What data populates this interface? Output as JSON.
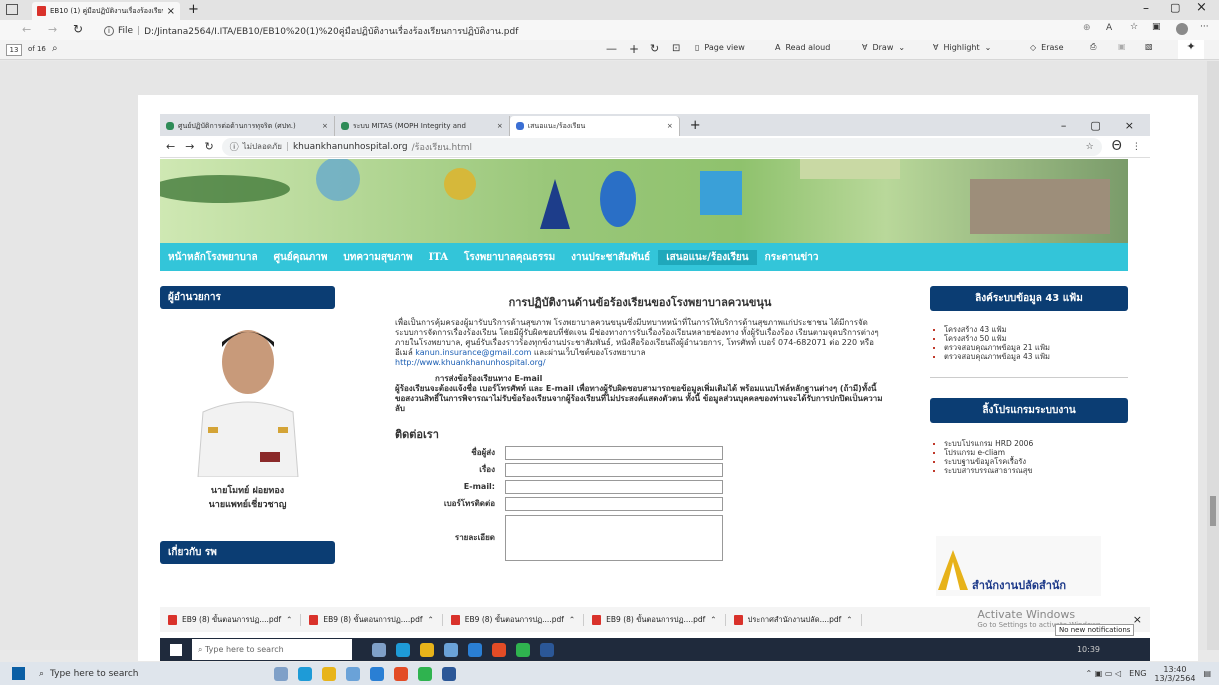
{
  "outer": {
    "tab_title": "EB10 (1) คู่มือปฏิบัติงานเรื่องร้องเรียน...",
    "tab_close": "×",
    "new_tab": "+",
    "file_label": "File",
    "url": "D:/Jintana2564/I.ITA/EB10/EB10%20(1)%20คู่มือปฏิบัติงานเรื่องร้องเรียนการปฏิบัติงาน.pdf",
    "page_num": "13",
    "page_of": "of 16",
    "page_view": "Page view",
    "read_aloud": "Read aloud",
    "draw": "Draw",
    "highlight": "Highlight",
    "erase": "Erase",
    "search_placeholder": "Type here to search",
    "lang": "ENG",
    "time": "13:40",
    "date": "13/3/2564"
  },
  "inner": {
    "tabs": [
      "ศูนย์ปฏิบัติการต่อต้านการทุจริต (ศปท.)",
      "ระบบ MITAS (MOPH Integrity and",
      "เสนอแนะ/ร้องเรียน"
    ],
    "not_secure": "ไม่ปลอดภัย",
    "url_host": "khuankhanunhospital.org",
    "url_path": "/ร้องเรียน.html",
    "nav": [
      "หน้าหลักโรงพยาบาล",
      "ศูนย์คุณภาพ",
      "บทความสุขภาพ",
      "ITA",
      "โรงพยาบาลคุณธรรม",
      "งานประชาสัมพันธ์",
      "เสนอแนะ/ร้องเรียน",
      "กระดานข่าว"
    ],
    "left_head": "ผู้อำนวยการ",
    "director_name": "นายโมทย์ ฝอยทอง",
    "director_title": "นายแพทย์เชี่ยวชาญ",
    "about_head": "เกี่ยวกับ รพ",
    "main_title": "การปฏิบัติงานด้านข้อร้องเรียนของโรงพยาบาลควนขนุน",
    "para1": "เพื่อเป็นการคุ้มครองผู้มารับบริการด้านสุขภาพ โรงพยาบาลควนขนุนซึ่งมีบทบาทหน้าที่ในการให้บริการด้านสุขภาพแก่ประชาชน ได้มีการจัดระบบการจัดการเรื่องร้องเรียน โดยมีผู้รับผิดชอบที่ชัดเจน มีช่องทางการรับเรื่องร้องเรียนหลายช่องทาง ทั้งผู้รับเรื่องร้อง เรียนตามจุดบริการต่างๆภายในโรงพยาบาล, ศูนย์รับเรื่องราวร้องทุกข์งานประชาสัมพันธ์, หนังสือร้องเรียนถึงผู้อำนวยการ, โทรศัพท์ เบอร์ 074-682071 ต่อ 220 หรือ อีเมล์",
    "email": "kanun.insurance@gmail.com",
    "para1b": "และผ่านเว็บไซต์ของโรงพยาบาล",
    "site_link": "http://www.khuankhanunhospital.org/",
    "email_head": "การส่งข้อร้องเรียนทาง E-mail",
    "para2": "ผู้ร้องเรียนจะต้องแจ้งชื่อ เบอร์โทรศัพท์ และ E-mail เพื่อทางผู้รับผิดชอบสามารถขอข้อมูลเพิ่มเติมได้ พร้อมแนบไฟล์หลักฐานต่างๆ (ถ้ามี)ทั้งนี้ขอสงวนสิทธิ์ในการพิจารณาไม่รับข้อร้องเรียนจากผู้ร้องเรียนที่ไม่ประสงค์แสดงตัวตน ทั้งนี้ ข้อมูลส่วนบุคคลของท่านจะได้รับการปกปิดเป็นความลับ",
    "contact_head": "ติดต่อเรา",
    "form_labels": [
      "ชื่อผู้ส่ง",
      "เรื่อง",
      "E-mail:",
      "เบอร์โทรติดต่อ"
    ],
    "details_label": "รายละเอียด",
    "right_head1": "ลิงค์ระบบข้อมูล 43 แฟ้ม",
    "right_list1": [
      "โครงสร้าง 43 แฟ้ม",
      "โครงสร้าง 50 แฟ้ม",
      "ตรวจสอบคุณภาพข้อมูล 21 แฟ้ม",
      "ตรวจสอบคุณภาพข้อมูล 43 แฟ้ม"
    ],
    "right_head2": "ลิ้งโปรแกรมระบบงาน",
    "right_list2": [
      "ระบบโปรแกรม HRD 2006",
      "โปรแกรม e-cliam",
      "ระบบฐานข้อมูลโรคเรื้อรัง",
      "ระบบสารบรรณสาธารณสุข"
    ],
    "logo_text": "สำนักงานปลัดสำนัก",
    "downloads": [
      "EB9 (8) ขั้นตอนการปฏ....pdf",
      "EB9 (8) ขั้นตอนการปฏ....pdf",
      "EB9 (8) ขั้นตอนการปฏ....pdf",
      "EB9 (8) ขั้นตอนการปฏ....pdf",
      "ประกาศสำนักงานปลัด....pdf"
    ],
    "activate_title": "Activate Windows",
    "activate_sub": "Go to Settings to activate Windows.",
    "notif": "No new notifications",
    "inner_search": "Type here to search",
    "inner_time": "10:39"
  }
}
